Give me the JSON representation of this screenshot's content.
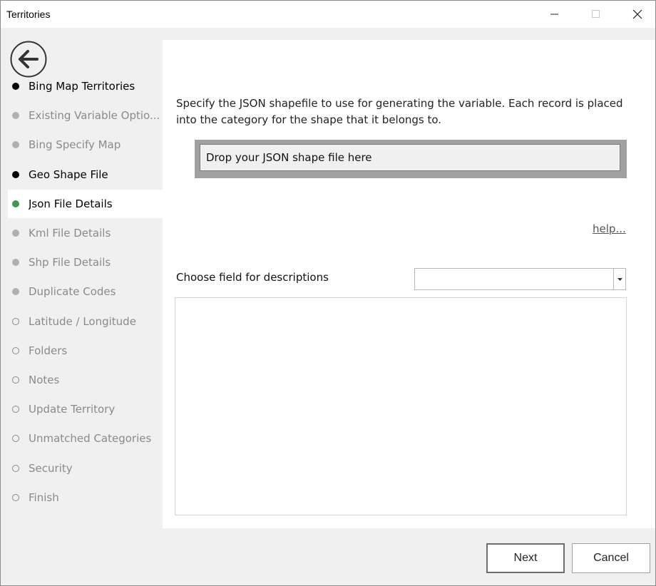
{
  "window": {
    "title": "Territories",
    "controls": {
      "minimize": "minimize-icon",
      "maximize": "maximize-icon",
      "close": "close-icon"
    }
  },
  "sidebar": {
    "back_icon": "back-arrow-icon",
    "steps": [
      {
        "label": "Bing Map Territories",
        "state": "done"
      },
      {
        "label": "Existing Variable Optio...",
        "state": "disabled"
      },
      {
        "label": "Bing Specify Map",
        "state": "disabled"
      },
      {
        "label": "Geo Shape File",
        "state": "done"
      },
      {
        "label": "Json File Details",
        "state": "current"
      },
      {
        "label": "Kml File Details",
        "state": "disabled"
      },
      {
        "label": "Shp File Details",
        "state": "disabled"
      },
      {
        "label": "Duplicate Codes",
        "state": "disabled"
      },
      {
        "label": "Latitude / Longitude",
        "state": "future"
      },
      {
        "label": "Folders",
        "state": "future"
      },
      {
        "label": "Notes",
        "state": "future"
      },
      {
        "label": "Update Territory",
        "state": "future"
      },
      {
        "label": "Unmatched Categories",
        "state": "future"
      },
      {
        "label": "Security",
        "state": "future"
      },
      {
        "label": "Finish",
        "state": "future"
      }
    ]
  },
  "main": {
    "description": "Specify the JSON shapefile to use for generating the variable. Each record is placed into the category for the shape that it belongs to.",
    "dropzone_text": "Drop your JSON shape file here",
    "help_link": "help...",
    "field_label": "Choose field for descriptions",
    "field_value": ""
  },
  "footer": {
    "next_label": "Next",
    "cancel_label": "Cancel"
  },
  "colors": {
    "current_step": "#3a9b4a",
    "done_step": "#000000",
    "disabled_step": "#b0b0b0"
  }
}
